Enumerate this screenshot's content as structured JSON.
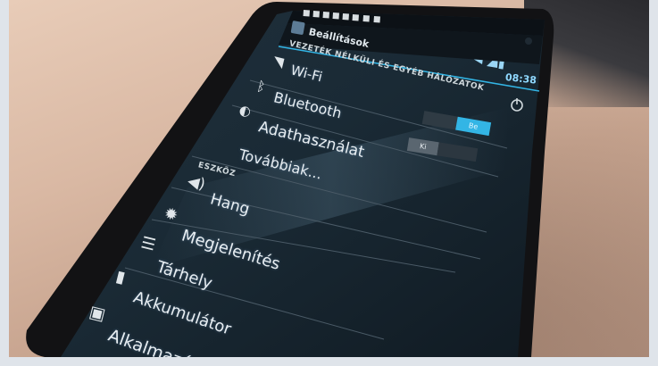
{
  "statusbar": {
    "time": "08:38"
  },
  "actionbar": {
    "title": "Beállítások"
  },
  "sections": {
    "wireless": "VEZETÉK NÉLKÜLI ÉS EGYÉB HÁLÓZATOK",
    "device": "ESZKÖZ"
  },
  "items": {
    "wifi": "Wi-Fi",
    "bluetooth": "Bluetooth",
    "data_usage": "Adathasználat",
    "more": "Továbbiak...",
    "sound": "Hang",
    "display": "Megjelenítés",
    "storage": "Tárhely",
    "battery": "Akkumulátor",
    "apps": "Alkalmazások"
  },
  "toggles": {
    "bluetooth_on": "Be",
    "data_off": "Ki"
  },
  "colors": {
    "accent": "#33b5e5",
    "screen": "#1b2630",
    "bezel": "#121214"
  },
  "icons": [
    "settings-icon",
    "wifi-icon",
    "bluetooth-icon",
    "data-usage-icon",
    "sound-icon",
    "brightness-icon",
    "storage-icon",
    "battery-icon",
    "apps-icon",
    "power-icon"
  ]
}
